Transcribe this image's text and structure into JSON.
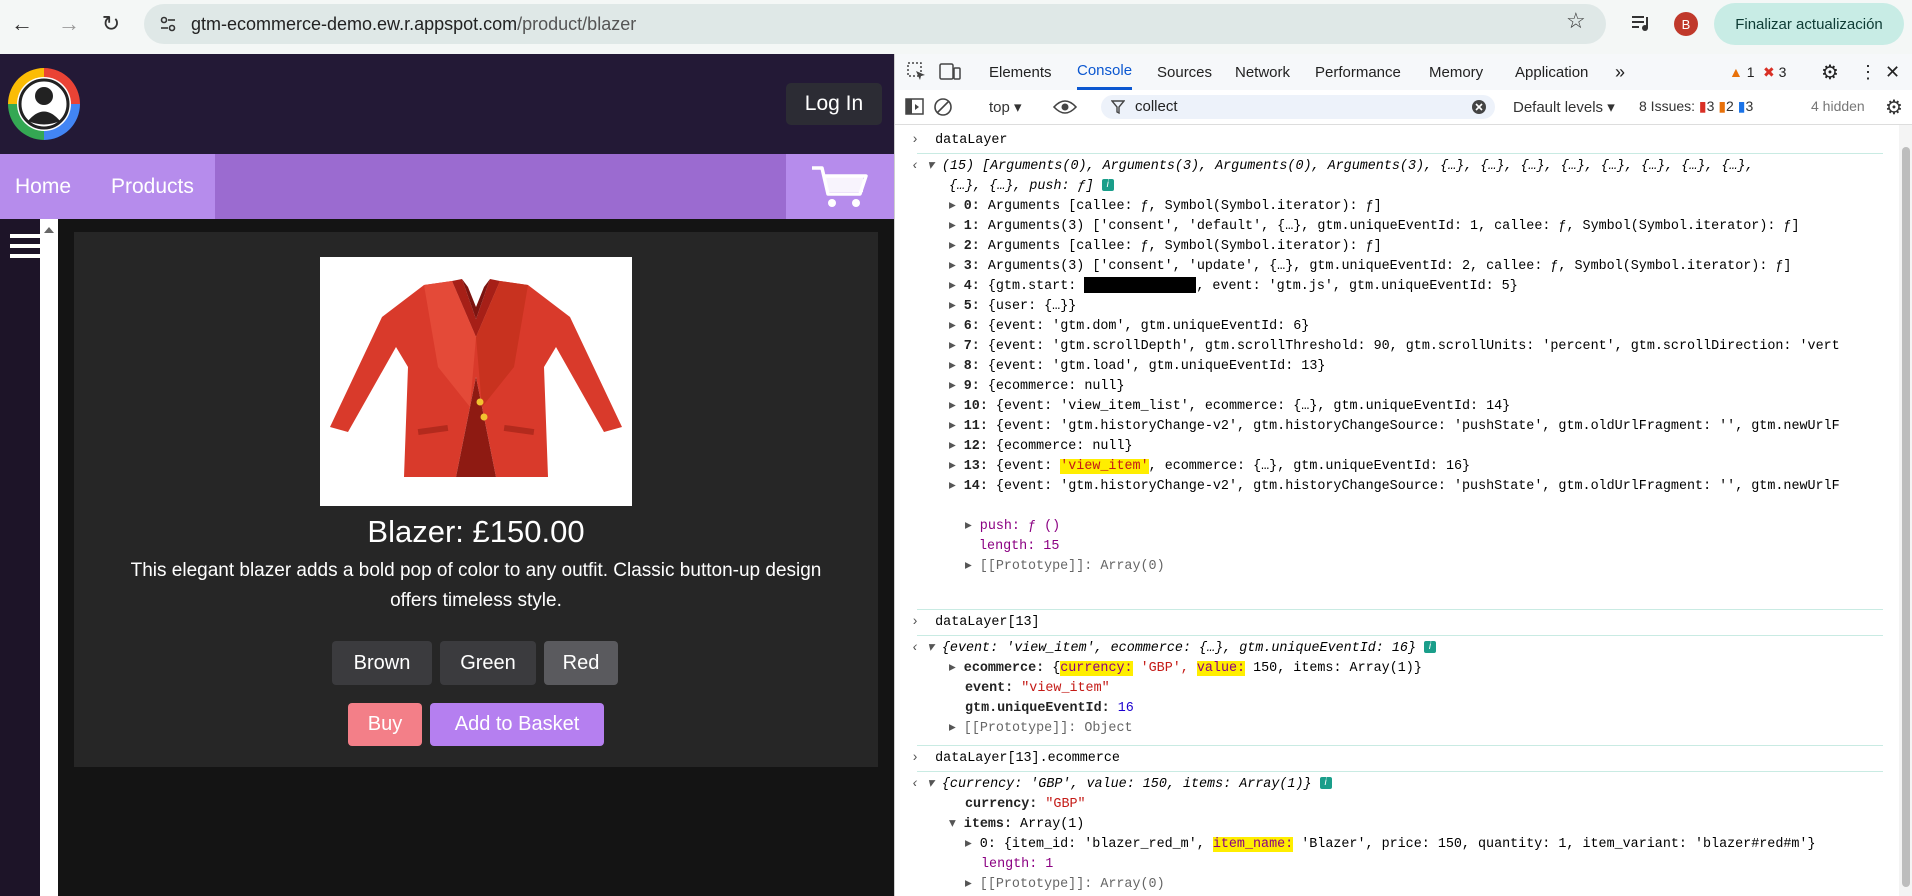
{
  "browser": {
    "url_host": "gtm-ecommerce-demo.ew.r.appspot.com",
    "url_path": "/product/blazer",
    "profile_initial": "B",
    "update_button": "Finalizar actualización"
  },
  "site": {
    "login": "Log In",
    "nav": [
      "Home",
      "Products"
    ],
    "product": {
      "title": "Blazer: £150.00",
      "description": "This elegant blazer adds a bold pop of color to any outfit. Classic button-up design offers timeless style.",
      "variants": [
        "Brown",
        "Green",
        "Red"
      ],
      "selected_variant": "Red",
      "buy": "Buy",
      "add_to_basket": "Add to Basket"
    }
  },
  "devtools": {
    "tabs": [
      "Elements",
      "Console",
      "Sources",
      "Network",
      "Performance",
      "Memory",
      "Application"
    ],
    "active_tab": "Console",
    "warning_count": "1",
    "error_count": "3",
    "context": "top",
    "filter": "collect",
    "levels": "Default levels",
    "issues_label": "8 Issues:",
    "issues_errors": "3",
    "issues_warnings": "2",
    "issues_info": "3",
    "hidden": "4 hidden",
    "console": {
      "cmd1": "dataLayer",
      "summary1a": "(15) [Arguments(0), Arguments(3), Arguments(0), Arguments(3), {…}, {…}, {…}, {…}, {…}, {…}, {…}, {…},",
      "summary1b": "{…}, {…}, push: ƒ]",
      "rows": [
        {
          "idx": "0:",
          "text": "Arguments [callee: ƒ, Symbol(Symbol.iterator): ƒ]"
        },
        {
          "idx": "1:",
          "text": "Arguments(3) ['consent', 'default', {…}, gtm.uniqueEventId: 1, callee: ƒ, Symbol(Symbol.iterator): ƒ]"
        },
        {
          "idx": "2:",
          "text": "Arguments [callee: ƒ, Symbol(Symbol.iterator): ƒ]"
        },
        {
          "idx": "3:",
          "text": "Arguments(3) ['consent', 'update', {…}, gtm.uniqueEventId: 2, callee: ƒ, Symbol(Symbol.iterator): ƒ]"
        },
        {
          "idx": "4:",
          "text": "{gtm.start: ",
          "tail": ", event: 'gtm.js', gtm.uniqueEventId: 5}"
        },
        {
          "idx": "5:",
          "text": "{user: {…}}"
        },
        {
          "idx": "6:",
          "text": "{event: 'gtm.dom', gtm.uniqueEventId: 6}"
        },
        {
          "idx": "7:",
          "text": "{event: 'gtm.scrollDepth', gtm.scrollThreshold: 90, gtm.scrollUnits: 'percent', gtm.scrollDirection: 'vert"
        },
        {
          "idx": "8:",
          "text": "{event: 'gtm.load', gtm.uniqueEventId: 13}"
        },
        {
          "idx": "9:",
          "text": "{ecommerce: null}"
        },
        {
          "idx": "10:",
          "text": "{event: 'view_item_list', ecommerce: {…}, gtm.uniqueEventId: 14}"
        },
        {
          "idx": "11:",
          "text": "{event: 'gtm.historyChange-v2', gtm.historyChangeSource: 'pushState', gtm.oldUrlFragment: '', gtm.newUrlF"
        },
        {
          "idx": "12:",
          "text": "{ecommerce: null}"
        },
        {
          "idx": "13:",
          "pre": "{event: ",
          "hl": "'view_item'",
          "post": ", ecommerce: {…}, gtm.uniqueEventId: 16}"
        },
        {
          "idx": "14:",
          "text": "{event: 'gtm.historyChange-v2', gtm.historyChangeSource: 'pushState', gtm.oldUrlFragment: '', gtm.newUrlF"
        }
      ],
      "push_line": "push: ƒ ()",
      "length_line": "length: 15",
      "proto_array": "[[Prototype]]: Array(0)",
      "cmd2": "dataLayer[13]",
      "summary2": "{event: 'view_item', ecommerce: {…}, gtm.uniqueEventId: 16}",
      "ecommerce_key": "ecommerce:",
      "ecommerce_val_pre": "{",
      "currency_hl": "currency:",
      "ecommerce_val_mid": " 'GBP', ",
      "value_hl": "value:",
      "ecommerce_val_post": " 150, items: Array(1)}",
      "event_line_key": "event:",
      "event_line_val": "\"view_item\"",
      "uid_key": "gtm.uniqueEventId:",
      "uid_val": "16",
      "proto_object": "[[Prototype]]: Object",
      "cmd3": "dataLayer[13].ecommerce",
      "summary3": "{currency: 'GBP', value: 150, items: Array(1)}",
      "currency_key": "currency:",
      "currency_val": "\"GBP\"",
      "items_key": "items:",
      "items_val": "Array(1)",
      "item0_pre": "0: {item_id: 'blazer_red_m', ",
      "item0_hl": "item_name:",
      "item0_post": " 'Blazer', price: 150, quantity: 1, item_variant: 'blazer#red#m'}",
      "length1": "length: 1",
      "value_key": "value:",
      "value_val": "150"
    }
  }
}
